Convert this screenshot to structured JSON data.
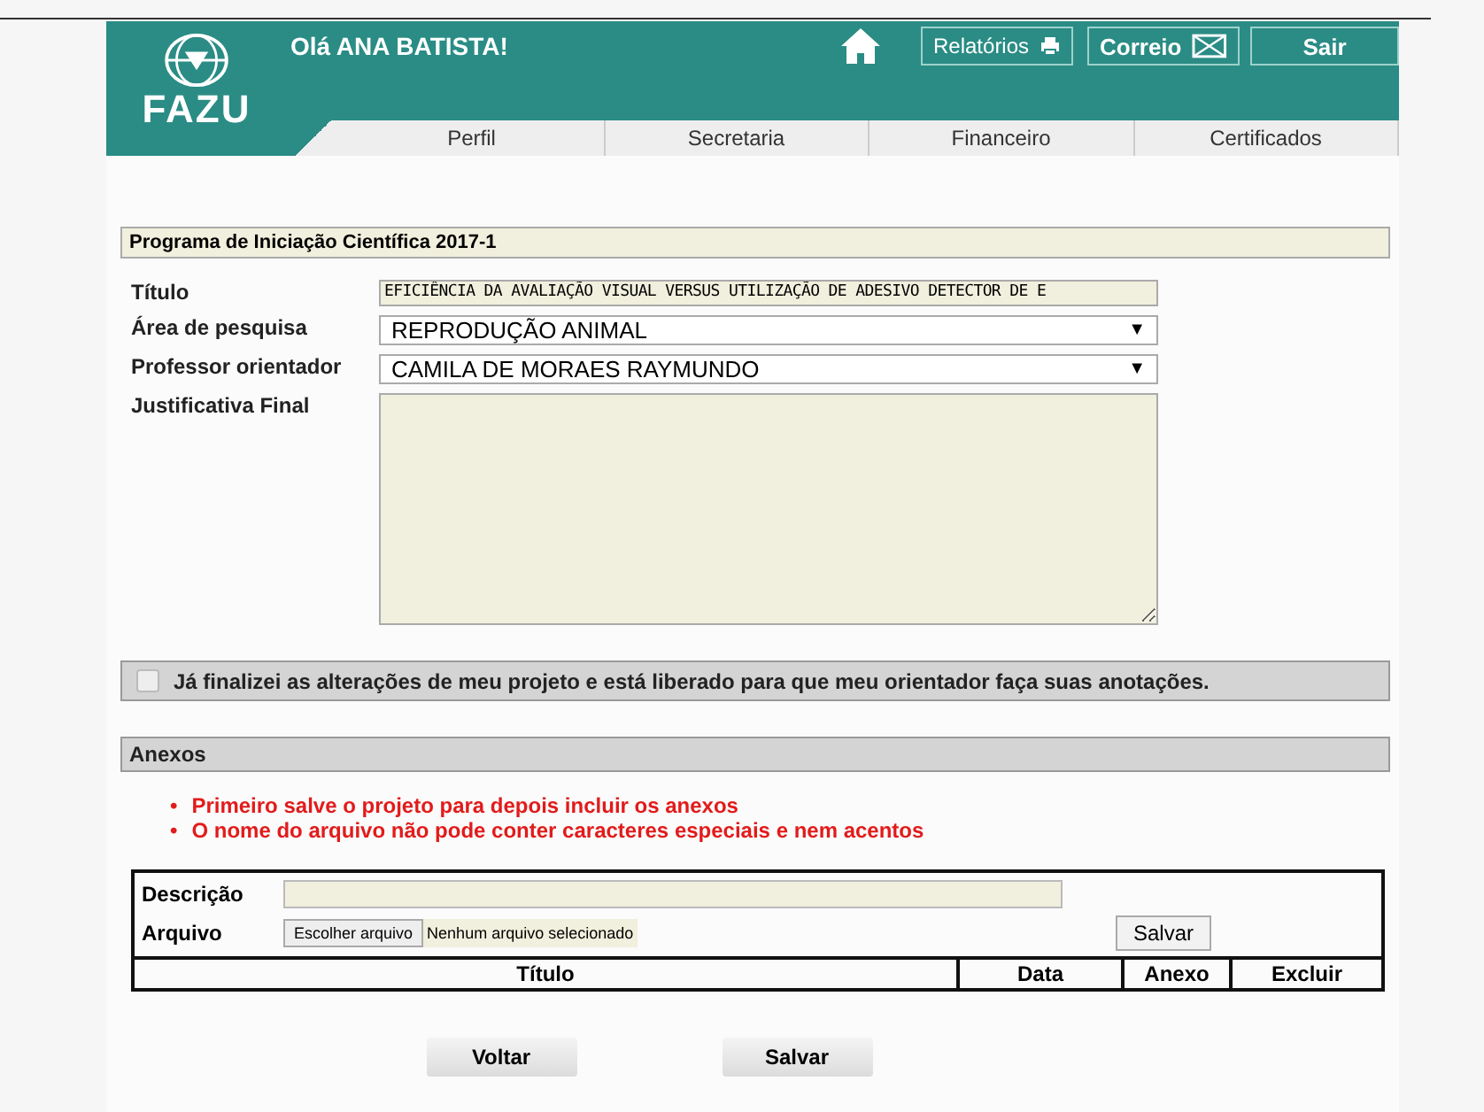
{
  "header": {
    "logo_text": "FAZU",
    "greeting": "Olá ANA BATISTA!",
    "buttons": [
      {
        "label": "Relatórios",
        "kind": "print",
        "bold": false
      },
      {
        "label": "Correio",
        "kind": "mail",
        "bold": true
      },
      {
        "label": "Sair",
        "kind": "plain",
        "bold": true
      }
    ]
  },
  "tabs": [
    {
      "label": "Perfil",
      "selected": false
    },
    {
      "label": "Secretaria",
      "selected": false
    },
    {
      "label": "Financeiro",
      "selected": false
    },
    {
      "label": "Certificados",
      "selected": false
    }
  ],
  "section_title": "Programa de Iniciação Científica 2017-1",
  "form": [
    {
      "label": "Título",
      "kind": "text",
      "value": "EFICIÊNCIA DA AVALIAÇÃO VISUAL VERSUS UTILIZAÇÃO DE ADESIVO DETECTOR DE E"
    },
    {
      "label": "Área de pesquisa",
      "kind": "select",
      "value": "REPRODUÇÃO ANIMAL",
      "arrow": "▼"
    },
    {
      "label": "Professor orientador",
      "kind": "select",
      "value": "CAMILA DE MORAES RAYMUNDO",
      "arrow": "▼"
    },
    {
      "label": "Justificativa Final",
      "kind": "textarea"
    }
  ],
  "release": {
    "label": "Já finalizei as alterações de meu projeto e está liberado para que meu orientador faça suas anotações.",
    "checked": false
  },
  "attachments": {
    "title": "Anexos",
    "bullet": "•",
    "notes": [
      "Primeiro salve o projeto para depois incluir os anexos",
      "O nome do arquivo não pode conter caracteres especiais e nem acentos"
    ],
    "description_label": "Descrição",
    "file_label": "Arquivo",
    "file_button": "Escolher arquivo",
    "file_status": "Nenhum arquivo selecionado",
    "save_button": "Salvar",
    "columns": [
      "Título",
      "Data",
      "Anexo",
      "Excluir"
    ]
  },
  "actions": [
    "Voltar",
    "Salvar"
  ]
}
